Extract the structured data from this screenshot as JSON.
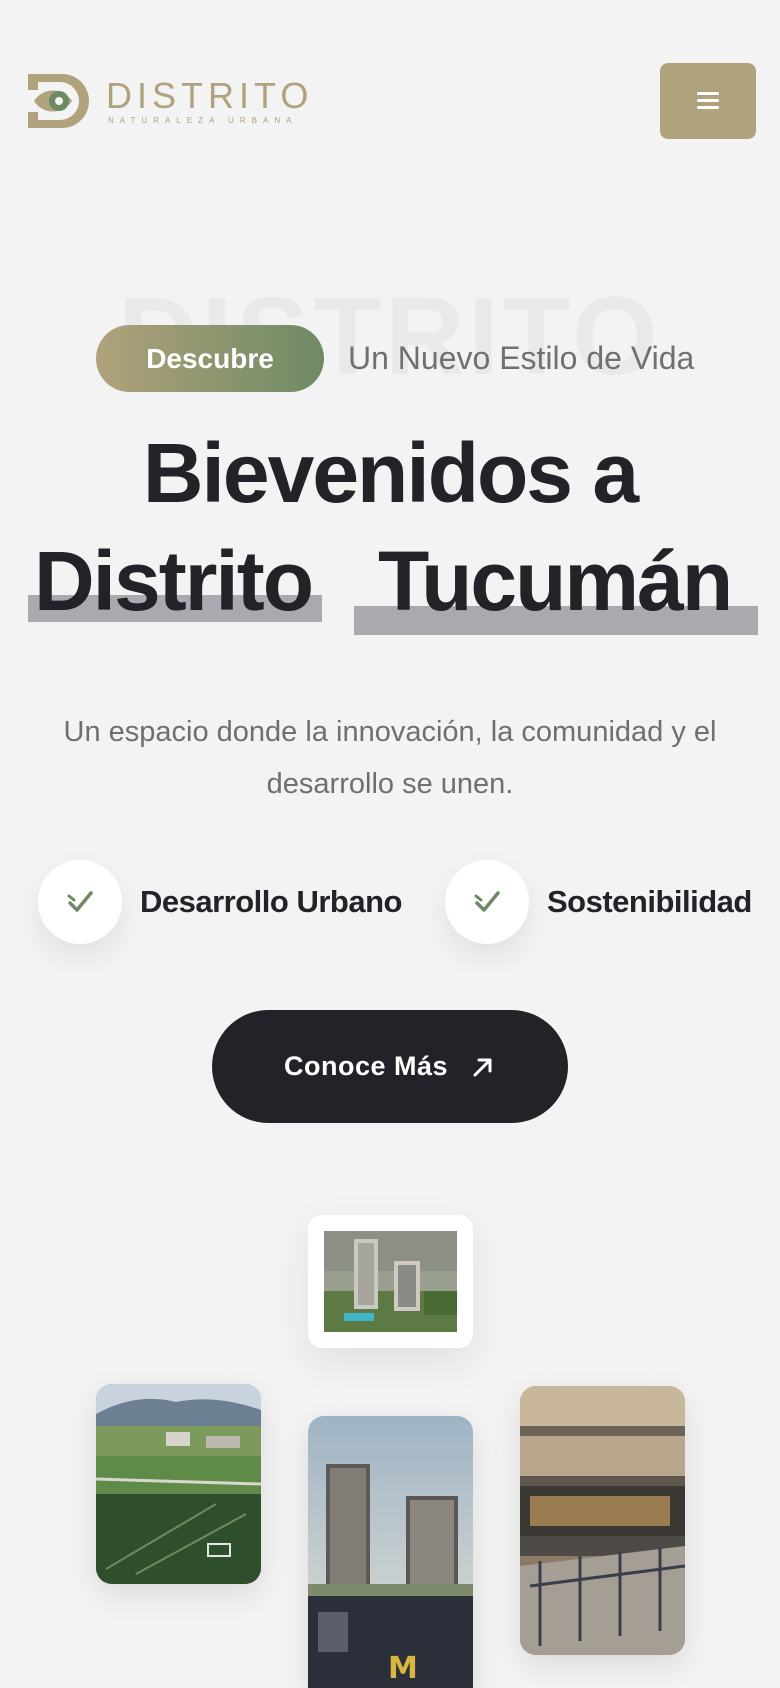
{
  "brand": {
    "name": "DISTRITO",
    "tagline": "NATURALEZA URBANA",
    "colors": {
      "gold": "#b0a27c",
      "green": "#6e8a64",
      "dark": "#222328",
      "background": "#f3f3f4"
    }
  },
  "header": {
    "menu_icon": "hamburger-icon"
  },
  "hero": {
    "watermark": "DISTRITO",
    "badge": "Descubre",
    "badge_subtitle": "Un Nuevo Estilo de Vida",
    "title_line1": "Bievenidos a",
    "title_word1": "Distrito",
    "title_word2": "Tucumán",
    "description": "Un espacio donde la innovación, la comunidad y el desarrollo se unen."
  },
  "features": [
    {
      "label": "Desarrollo Urbano",
      "icon": "check-icon"
    },
    {
      "label": "Sostenibilidad",
      "icon": "check-icon"
    }
  ],
  "cta": {
    "label": "Conoce Más",
    "icon": "arrow-up-right-icon"
  },
  "gallery": {
    "images": [
      {
        "subject": "towers-aerial-photo"
      },
      {
        "subject": "sports-field-photo"
      },
      {
        "subject": "towers-street-photo"
      },
      {
        "subject": "building-terrace-photo"
      }
    ]
  }
}
